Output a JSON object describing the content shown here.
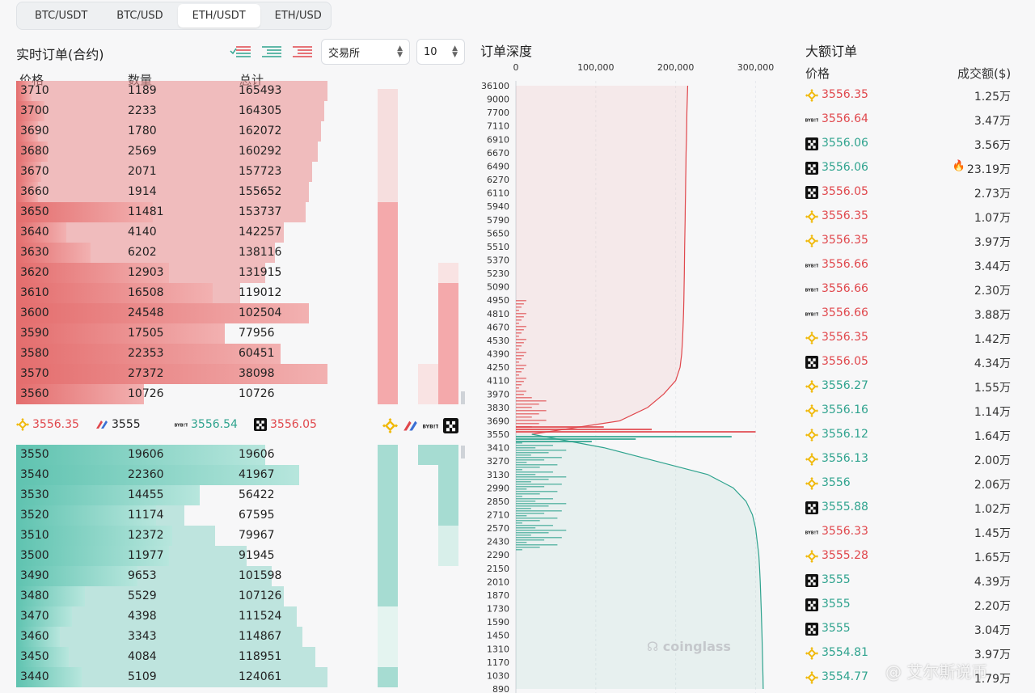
{
  "tabs": [
    "BTC/USDT",
    "BTC/USD",
    "ETH/USDT",
    "ETH/USD"
  ],
  "active_tab": 2,
  "orderbook": {
    "title": "实时订单(合约)",
    "exchange_select": "交易所",
    "depth_select": "10",
    "col_price": "价格",
    "col_qty": "数量",
    "col_total": "总计",
    "asks": [
      {
        "price": "3710",
        "qty": "1189",
        "total": "165493",
        "qty_frac": 0.05,
        "total_frac": 1.0
      },
      {
        "price": "3700",
        "qty": "2233",
        "total": "164305",
        "qty_frac": 0.09,
        "total_frac": 0.99
      },
      {
        "price": "3690",
        "qty": "1780",
        "total": "162072",
        "qty_frac": 0.07,
        "total_frac": 0.98
      },
      {
        "price": "3680",
        "qty": "2569",
        "total": "160292",
        "qty_frac": 0.1,
        "total_frac": 0.97
      },
      {
        "price": "3670",
        "qty": "2071",
        "total": "157723",
        "qty_frac": 0.08,
        "total_frac": 0.95
      },
      {
        "price": "3660",
        "qty": "1914",
        "total": "155652",
        "qty_frac": 0.07,
        "total_frac": 0.94
      },
      {
        "price": "3650",
        "qty": "11481",
        "total": "153737",
        "qty_frac": 0.44,
        "total_frac": 0.93
      },
      {
        "price": "3640",
        "qty": "4140",
        "total": "142257",
        "qty_frac": 0.16,
        "total_frac": 0.86
      },
      {
        "price": "3630",
        "qty": "6202",
        "total": "138116",
        "qty_frac": 0.24,
        "total_frac": 0.83
      },
      {
        "price": "3620",
        "qty": "12903",
        "total": "131915",
        "qty_frac": 0.49,
        "total_frac": 0.8
      },
      {
        "price": "3610",
        "qty": "16508",
        "total": "119012",
        "qty_frac": 0.63,
        "total_frac": 0.72
      },
      {
        "price": "3600",
        "qty": "24548",
        "total": "102504",
        "qty_frac": 0.94,
        "total_frac": 0.62
      },
      {
        "price": "3590",
        "qty": "17505",
        "total": "77956",
        "qty_frac": 0.67,
        "total_frac": 0.47
      },
      {
        "price": "3580",
        "qty": "22353",
        "total": "60451",
        "qty_frac": 0.85,
        "total_frac": 0.37
      },
      {
        "price": "3570",
        "qty": "27372",
        "total": "38098",
        "qty_frac": 1.0,
        "total_frac": 0.23
      },
      {
        "price": "3560",
        "qty": "10726",
        "total": "10726",
        "qty_frac": 0.41,
        "total_frac": 0.06
      }
    ],
    "bids": [
      {
        "price": "3550",
        "qty": "19606",
        "total": "19606",
        "qty_frac": 0.8,
        "total_frac": 0.15
      },
      {
        "price": "3540",
        "qty": "22360",
        "total": "41967",
        "qty_frac": 0.91,
        "total_frac": 0.34
      },
      {
        "price": "3530",
        "qty": "14455",
        "total": "56422",
        "qty_frac": 0.59,
        "total_frac": 0.45
      },
      {
        "price": "3520",
        "qty": "11174",
        "total": "67595",
        "qty_frac": 0.45,
        "total_frac": 0.54
      },
      {
        "price": "3510",
        "qty": "12372",
        "total": "79967",
        "qty_frac": 0.5,
        "total_frac": 0.64
      },
      {
        "price": "3500",
        "qty": "11977",
        "total": "91945",
        "qty_frac": 0.49,
        "total_frac": 0.74
      },
      {
        "price": "3490",
        "qty": "9653",
        "total": "101598",
        "qty_frac": 0.39,
        "total_frac": 0.82
      },
      {
        "price": "3480",
        "qty": "5529",
        "total": "107126",
        "qty_frac": 0.22,
        "total_frac": 0.86
      },
      {
        "price": "3470",
        "qty": "4398",
        "total": "111524",
        "qty_frac": 0.18,
        "total_frac": 0.9
      },
      {
        "price": "3460",
        "qty": "3343",
        "total": "114867",
        "qty_frac": 0.14,
        "total_frac": 0.92
      },
      {
        "price": "3450",
        "qty": "4084",
        "total": "118951",
        "qty_frac": 0.17,
        "total_frac": 0.96
      },
      {
        "price": "3440",
        "qty": "5109",
        "total": "124061",
        "qty_frac": 0.21,
        "total_frac": 1.0
      }
    ],
    "mid_prices": [
      {
        "exchange": "binance",
        "price": "3556.35",
        "color": "red"
      },
      {
        "exchange": "bitmex",
        "price": "3555",
        "color": "dark"
      },
      {
        "exchange": "bybit",
        "price": "3556.54",
        "color": "green"
      },
      {
        "exchange": "okx",
        "price": "3556.05",
        "color": "red"
      }
    ]
  },
  "depth": {
    "title": "订单深度",
    "x_ticks": [
      "0",
      "100,000",
      "200,000",
      "300,000"
    ],
    "y_ticks": [
      "36100",
      "9000",
      "7700",
      "7110",
      "6910",
      "6670",
      "6490",
      "6270",
      "6110",
      "5940",
      "5790",
      "5650",
      "5510",
      "5370",
      "5230",
      "5090",
      "4950",
      "4810",
      "4670",
      "4530",
      "4390",
      "4250",
      "4110",
      "3970",
      "3830",
      "3690",
      "3550",
      "3410",
      "3270",
      "3130",
      "2990",
      "2850",
      "2710",
      "2570",
      "2430",
      "2290",
      "2150",
      "2010",
      "1870",
      "1730",
      "1590",
      "1450",
      "1310",
      "1170",
      "1030",
      "890"
    ],
    "brand": "coinglass"
  },
  "chart_data": {
    "type": "area",
    "title": "订单深度",
    "categories": [
      "36100",
      "9000",
      "7700",
      "7110",
      "6910",
      "6670",
      "6490",
      "6270",
      "6110",
      "5940",
      "5790",
      "5650",
      "5510",
      "5370",
      "5230",
      "5090",
      "4950",
      "4810",
      "4670",
      "4530",
      "4390",
      "4250",
      "4110",
      "3970",
      "3830",
      "3690",
      "3550",
      "3410",
      "3270",
      "3130",
      "2990",
      "2850",
      "2710",
      "2570",
      "2430",
      "2290",
      "2150",
      "2010",
      "1870",
      "1730",
      "1590",
      "1450",
      "1310",
      "1170",
      "1030",
      "890"
    ],
    "series": [
      {
        "side": "ask",
        "values": [
          215000,
          214500,
          214000,
          213800,
          213500,
          213000,
          212800,
          212500,
          212300,
          212000,
          211800,
          211500,
          211200,
          211000,
          210800,
          210500,
          210200,
          209800,
          209200,
          208500,
          207500,
          205500,
          200000,
          185000,
          165000,
          130000,
          20000,
          0,
          0,
          0,
          0,
          0,
          0,
          0,
          0,
          0,
          0,
          0,
          0,
          0,
          0,
          0,
          0,
          0,
          0,
          0
        ]
      },
      {
        "side": "bid",
        "values": [
          0,
          0,
          0,
          0,
          0,
          0,
          0,
          0,
          0,
          0,
          0,
          0,
          0,
          0,
          0,
          0,
          0,
          0,
          0,
          0,
          0,
          0,
          0,
          0,
          0,
          0,
          20000,
          110000,
          175000,
          240000,
          272000,
          288000,
          296000,
          300000,
          302000,
          304000,
          305000,
          305800,
          306400,
          307000,
          307500,
          308000,
          308400,
          308800,
          309200,
          309500
        ]
      }
    ],
    "xlim": [
      0,
      340000
    ],
    "orientation": "horizontal",
    "grid": true
  },
  "large_orders": {
    "title": "大额订单",
    "col_price": "价格",
    "col_amount": "成交额($)",
    "rows": [
      {
        "exchange": "binance",
        "price": "3556.35",
        "side": "red",
        "amount": "1.25万"
      },
      {
        "exchange": "bybit",
        "price": "3556.64",
        "side": "red",
        "amount": "3.47万"
      },
      {
        "exchange": "okx",
        "price": "3556.06",
        "side": "green",
        "amount": "3.56万"
      },
      {
        "exchange": "okx",
        "price": "3556.06",
        "side": "green",
        "amount": "23.19万",
        "hot": true
      },
      {
        "exchange": "okx",
        "price": "3556.05",
        "side": "red",
        "amount": "2.73万"
      },
      {
        "exchange": "binance",
        "price": "3556.35",
        "side": "red",
        "amount": "1.07万"
      },
      {
        "exchange": "binance",
        "price": "3556.35",
        "side": "red",
        "amount": "3.97万"
      },
      {
        "exchange": "bybit",
        "price": "3556.66",
        "side": "red",
        "amount": "3.44万"
      },
      {
        "exchange": "bybit",
        "price": "3556.66",
        "side": "red",
        "amount": "2.30万"
      },
      {
        "exchange": "bybit",
        "price": "3556.66",
        "side": "red",
        "amount": "3.88万"
      },
      {
        "exchange": "binance",
        "price": "3556.35",
        "side": "red",
        "amount": "1.42万"
      },
      {
        "exchange": "okx",
        "price": "3556.05",
        "side": "red",
        "amount": "4.34万"
      },
      {
        "exchange": "binance",
        "price": "3556.27",
        "side": "green",
        "amount": "1.55万"
      },
      {
        "exchange": "binance",
        "price": "3556.16",
        "side": "green",
        "amount": "1.14万"
      },
      {
        "exchange": "binance",
        "price": "3556.12",
        "side": "green",
        "amount": "1.64万"
      },
      {
        "exchange": "binance",
        "price": "3556.13",
        "side": "green",
        "amount": "2.00万"
      },
      {
        "exchange": "binance",
        "price": "3556",
        "side": "green",
        "amount": "2.06万"
      },
      {
        "exchange": "okx",
        "price": "3555.88",
        "side": "green",
        "amount": "1.02万"
      },
      {
        "exchange": "bybit",
        "price": "3556.33",
        "side": "red",
        "amount": "1.45万"
      },
      {
        "exchange": "binance",
        "price": "3555.28",
        "side": "red",
        "amount": "1.65万"
      },
      {
        "exchange": "okx",
        "price": "3555",
        "side": "green",
        "amount": "4.39万"
      },
      {
        "exchange": "okx",
        "price": "3555",
        "side": "green",
        "amount": "2.20万"
      },
      {
        "exchange": "okx",
        "price": "3555",
        "side": "green",
        "amount": "3.04万"
      },
      {
        "exchange": "binance",
        "price": "3554.81",
        "side": "green",
        "amount": "3.97万"
      },
      {
        "exchange": "binance",
        "price": "3554.77",
        "side": "green",
        "amount": "1.79万"
      }
    ]
  },
  "watermark": "@ 艾尔斯说币",
  "colors": {
    "ask": "#e0474c",
    "bid": "#2fa38e",
    "binance": "#f0b90b"
  }
}
